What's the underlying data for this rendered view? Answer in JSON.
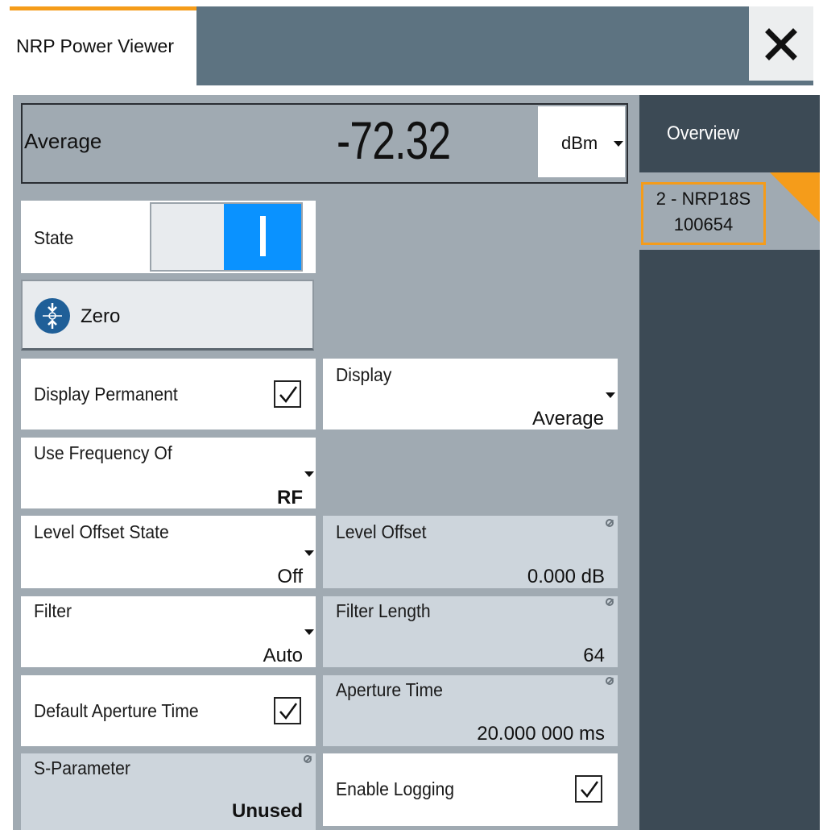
{
  "window": {
    "tab_title": "NRP Power Viewer",
    "close_icon": "close-icon"
  },
  "measurement": {
    "label": "Average",
    "value": "-72.32",
    "unit": "dBm"
  },
  "sidebar": {
    "overview_label": "Overview",
    "sensor_line1": "2 - NRP18S",
    "sensor_line2": "100654",
    "accent_color": "#f59c1a"
  },
  "state": {
    "label": "State",
    "on": true,
    "on_color": "#0a92ff"
  },
  "zero": {
    "label": "Zero",
    "icon": "zero-icon"
  },
  "fields": {
    "display_permanent": {
      "label": "Display Permanent",
      "checked": true
    },
    "display": {
      "label": "Display",
      "value": "Average"
    },
    "use_frequency_of": {
      "label": "Use Frequency Of",
      "value": "RF"
    },
    "level_offset_state": {
      "label": "Level Offset State",
      "value": "Off"
    },
    "level_offset": {
      "label": "Level Offset",
      "value": "0.000 dB"
    },
    "filter": {
      "label": "Filter",
      "value": "Auto"
    },
    "filter_length": {
      "label": "Filter Length",
      "value": "64"
    },
    "default_aperture_time": {
      "label": "Default Aperture Time",
      "checked": true
    },
    "aperture_time": {
      "label": "Aperture Time",
      "value": "20.000 000 ms"
    },
    "s_parameter": {
      "label": "S-Parameter",
      "value": "Unused"
    },
    "enable_logging": {
      "label": "Enable Logging",
      "checked": true
    }
  }
}
